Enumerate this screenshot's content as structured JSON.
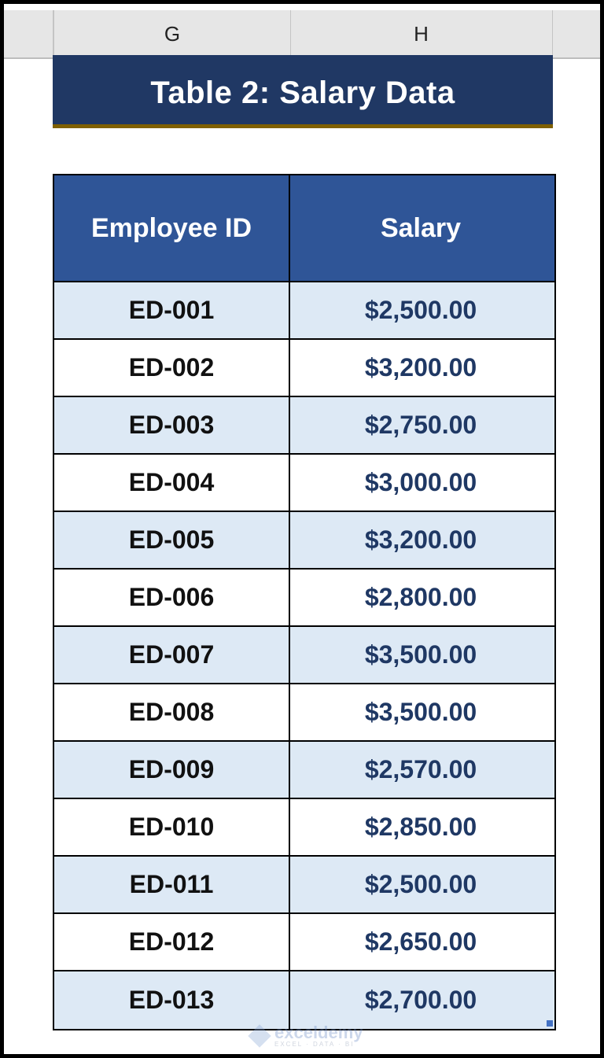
{
  "spreadsheet": {
    "column_headers": [
      "G",
      "H"
    ]
  },
  "title": "Table 2: Salary Data",
  "table": {
    "headers": {
      "employee_id": "Employee ID",
      "salary": "Salary"
    },
    "rows": [
      {
        "id": "ED-001",
        "salary": "$2,500.00"
      },
      {
        "id": "ED-002",
        "salary": "$3,200.00"
      },
      {
        "id": "ED-003",
        "salary": "$2,750.00"
      },
      {
        "id": "ED-004",
        "salary": "$3,000.00"
      },
      {
        "id": "ED-005",
        "salary": "$3,200.00"
      },
      {
        "id": "ED-006",
        "salary": "$2,800.00"
      },
      {
        "id": "ED-007",
        "salary": "$3,500.00"
      },
      {
        "id": "ED-008",
        "salary": "$3,500.00"
      },
      {
        "id": "ED-009",
        "salary": "$2,570.00"
      },
      {
        "id": "ED-010",
        "salary": "$2,850.00"
      },
      {
        "id": "ED-011",
        "salary": "$2,500.00"
      },
      {
        "id": "ED-012",
        "salary": "$2,650.00"
      },
      {
        "id": "ED-013",
        "salary": "$2,700.00"
      }
    ]
  },
  "watermark": {
    "name": "exceldemy",
    "tagline": "EXCEL · DATA · BI"
  },
  "colors": {
    "title_bg": "#203864",
    "title_underline": "#7f6000",
    "header_bg": "#2f5597",
    "band_row_bg": "#dde9f5",
    "salary_text": "#1f3864"
  }
}
